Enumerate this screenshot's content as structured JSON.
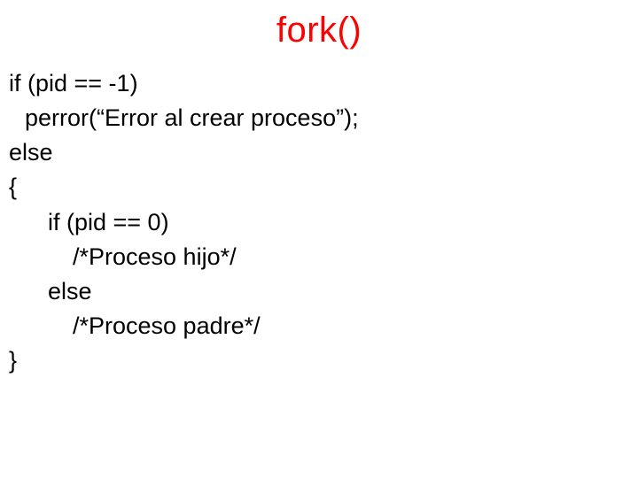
{
  "title": "fork()",
  "code": {
    "line1": "if (pid == -1)",
    "line2": "perror(“Error al crear proceso”);",
    "line3": "else",
    "line4": "{",
    "line5": "if (pid == 0)",
    "line6": "/*Proceso hijo*/",
    "line7": "else",
    "line8": "/*Proceso padre*/",
    "line9": "}"
  }
}
